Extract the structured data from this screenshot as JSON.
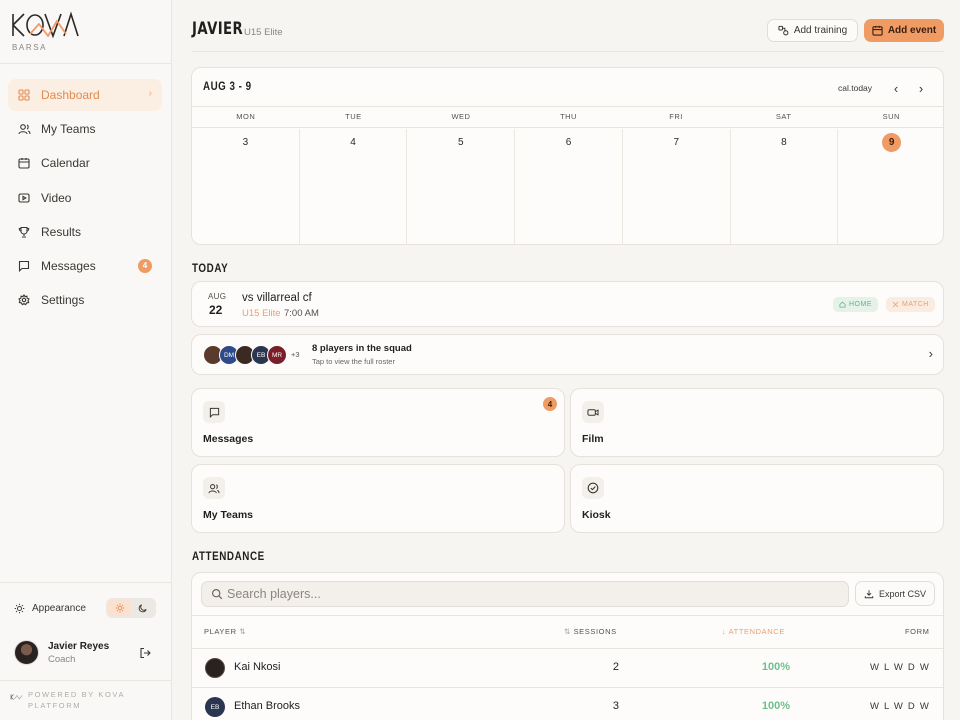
{
  "brand": {
    "logo_text": "KOVA",
    "club": "BARSA"
  },
  "sidebar": {
    "items": [
      {
        "label": "Dashboard",
        "icon": "grid-icon"
      },
      {
        "label": "My Teams",
        "icon": "users-icon"
      },
      {
        "label": "Calendar",
        "icon": "calendar-icon"
      },
      {
        "label": "Video",
        "icon": "video-icon"
      },
      {
        "label": "Results",
        "icon": "trophy-icon"
      },
      {
        "label": "Messages",
        "icon": "message-icon",
        "badge": "4"
      },
      {
        "label": "Settings",
        "icon": "gear-icon"
      }
    ],
    "appearance_label": "Appearance",
    "user": {
      "name": "Javier Reyes",
      "role": "Coach"
    },
    "powered_by": "POWERED BY KOVA PLATFORM"
  },
  "header": {
    "title": "JAVIER",
    "subtitle": "U15 Elite",
    "add_training_label": "Add training",
    "add_event_label": "Add event"
  },
  "calendar": {
    "range": "AUG 3 - 9",
    "today_label": "cal.today",
    "days": [
      {
        "name": "MON",
        "num": "3"
      },
      {
        "name": "TUE",
        "num": "4"
      },
      {
        "name": "WED",
        "num": "5"
      },
      {
        "name": "THU",
        "num": "6"
      },
      {
        "name": "FRI",
        "num": "7"
      },
      {
        "name": "SAT",
        "num": "8"
      },
      {
        "name": "SUN",
        "num": "9"
      }
    ]
  },
  "today": {
    "section_title": "TODAY",
    "event": {
      "month": "AUG",
      "day": "22",
      "title": "vs villarreal cf",
      "team": "U15 Elite",
      "time": "7:00 AM",
      "tag_home": "HOME",
      "tag_match": "MATCH"
    }
  },
  "squad": {
    "avatars": [
      {
        "initials": "",
        "color": "#5a3a2a"
      },
      {
        "initials": "DM",
        "color": "#2e4a8a"
      },
      {
        "initials": "",
        "color": "#3a2a22"
      },
      {
        "initials": "EB",
        "color": "#2a3550"
      },
      {
        "initials": "MR",
        "color": "#7a1f2a"
      }
    ],
    "more": "+3",
    "title": "8 players in the squad",
    "subtitle": "Tap to view the full roster"
  },
  "tiles": {
    "messages": {
      "label": "Messages",
      "badge": "4"
    },
    "film": {
      "label": "Film"
    },
    "teams": {
      "label": "My Teams"
    },
    "kiosk": {
      "label": "Kiosk"
    }
  },
  "attendance": {
    "section_title": "ATTENDANCE",
    "search_placeholder": "Search players...",
    "export_label": "Export CSV",
    "columns": {
      "player": "PLAYER",
      "sessions": "SESSIONS",
      "attendance": "ATTENDANCE",
      "form": "FORM"
    },
    "rows": [
      {
        "name": "Kai Nkosi",
        "initials": "",
        "avatar_color": "#2a2220",
        "sessions": "2",
        "attendance": "100%",
        "form": "W L W D W"
      },
      {
        "name": "Ethan Brooks",
        "initials": "EB",
        "avatar_color": "#2a3550",
        "sessions": "3",
        "attendance": "100%",
        "form": "W L W D W"
      }
    ]
  },
  "colors": {
    "accent": "#ef9b63",
    "accent_text": "#e58a4e",
    "success": "#6cc08c"
  }
}
